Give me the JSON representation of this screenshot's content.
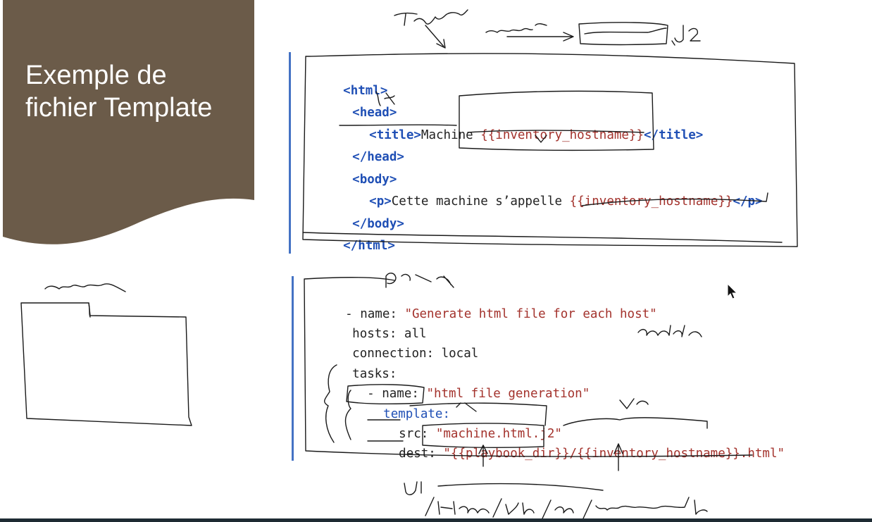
{
  "slide": {
    "title_line1": "Exemple de",
    "title_line2": "fichier Template",
    "colors": {
      "panel": "#6b5b49",
      "tag": "#1f4fb5",
      "string": "#a3322c",
      "text": "#222222",
      "accent_bar": "#4472c4"
    }
  },
  "html_code": {
    "l1": "<html>",
    "l2": "<head>",
    "l3_open": "<title>",
    "l3_text": "Machine ",
    "l3_var": "{{inventory_hostname}}",
    "l3_close": "</title>",
    "l4": "</head>",
    "l5": "<body>",
    "l6_open": "<p>",
    "l6_text": "Cette machine s’appelle ",
    "l6_var": "{{inventory_hostname}}",
    "l6_close": "</p>",
    "l7": "</body>",
    "l8": "</html>"
  },
  "yaml_code": {
    "l1_key": "- name: ",
    "l1_val": "\"Generate html file for each host\"",
    "l2": "hosts: all",
    "l3": "connection: local",
    "l4": "tasks:",
    "l5_key": "- name: ",
    "l5_val": "\"html file generation\"",
    "l6": "template:",
    "l7_key": "src: ",
    "l7_val": "\"machine.html.j2\"",
    "l8_key": "dest: ",
    "l8_val": "\"{{playbook_dir}}/{{inventory_hostname}}.html\""
  }
}
